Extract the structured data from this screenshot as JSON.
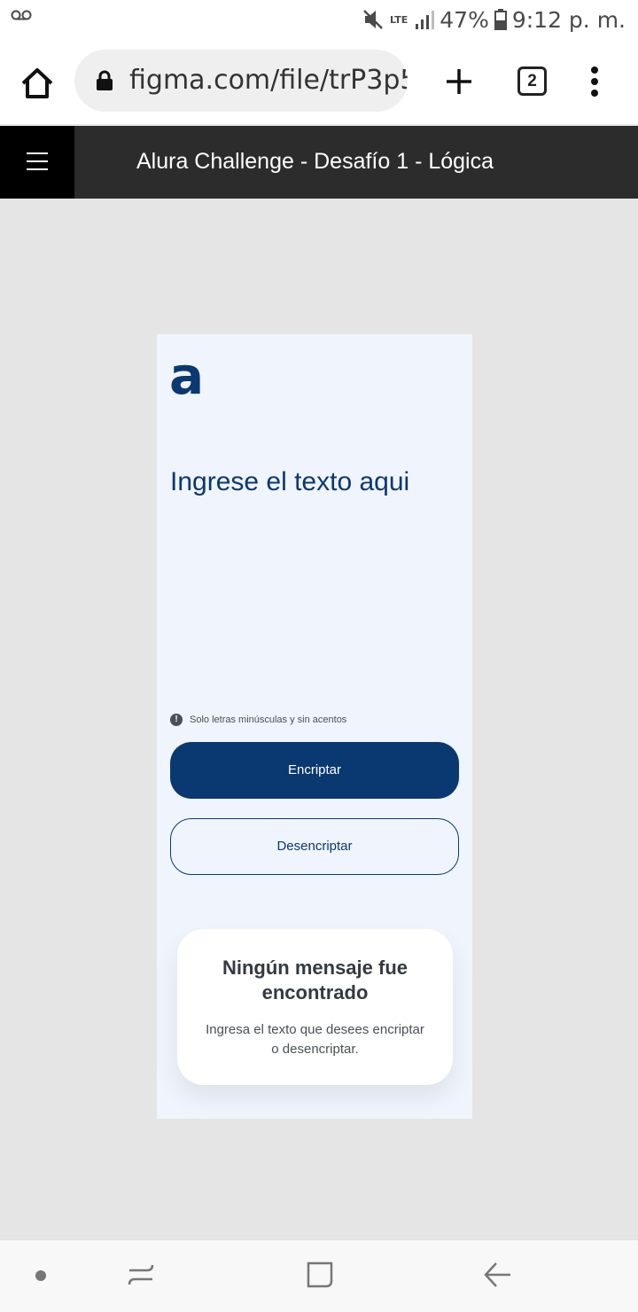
{
  "status_bar": {
    "network": "LTE",
    "battery": "47%",
    "time": "9:12 p. m.",
    "icons": [
      "voicemail-icon",
      "mute-icon",
      "signal-icon",
      "battery-icon"
    ]
  },
  "browser": {
    "url": "figma.com/file/trP3p5",
    "tab_count": "2",
    "icons": [
      "home-icon",
      "lock-icon",
      "plus-icon",
      "tabs-icon",
      "more-vert-icon"
    ]
  },
  "figma": {
    "title": "Alura Challenge - Desafío 1 - Lógica",
    "menu_icon": "hamburger-icon"
  },
  "design": {
    "logo": "a",
    "prompt": "Ingrese el texto aqui",
    "hint_icon_glyph": "!",
    "hint": "Solo letras minúsculas y sin acentos",
    "encrypt_label": "Encriptar",
    "decrypt_label": "Desencriptar",
    "card": {
      "title": "Ningún mensaje fue encontrado",
      "body": "Ingresa el texto que desees encriptar o desencriptar."
    },
    "colors": {
      "primary": "#0a3871",
      "background": "#f0f4fc",
      "card_title": "#343a40",
      "card_text": "#495057"
    }
  },
  "nav_bar": {
    "icons": [
      "dot-icon",
      "recent-apps-icon",
      "home-square-icon",
      "back-icon"
    ]
  }
}
